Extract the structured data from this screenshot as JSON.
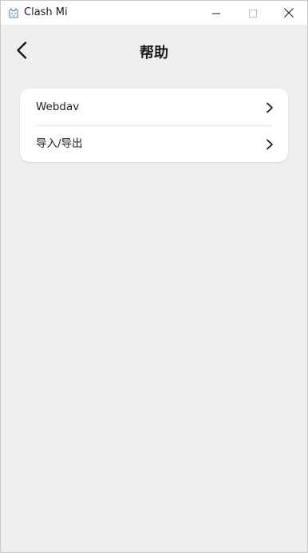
{
  "window": {
    "title": "Clash Mi",
    "app_icon": "clash-mi-cat-icon",
    "controls": [
      "minimize-icon",
      "maximize-icon",
      "close-icon"
    ]
  },
  "header": {
    "title": "帮助",
    "back_icon": "chevron-left-icon"
  },
  "menu": {
    "items": [
      {
        "label": "Webdav",
        "icon": "chevron-right-icon"
      },
      {
        "label": "导入/导出",
        "icon": "chevron-right-icon"
      }
    ]
  },
  "colors": {
    "background": "#efefef",
    "card": "#ffffff",
    "text": "#222222"
  }
}
